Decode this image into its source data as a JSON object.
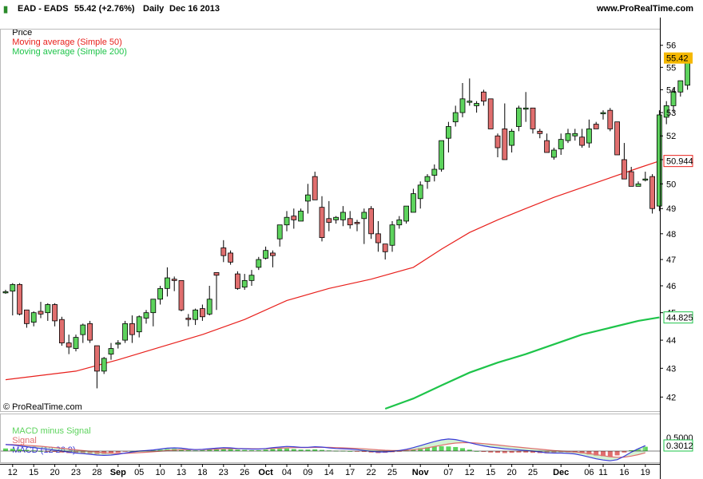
{
  "header": {
    "symbol": "EAD - EADS",
    "last_change": "55.42 (+2.76%)",
    "period": "Daily",
    "date": "Dec 16 2013",
    "site": "www.ProRealTime.com"
  },
  "legend": {
    "price": "Price",
    "ma50": "Moving average (Simple 50)",
    "ma200": "Moving average (Simple 200)",
    "macd_hist": "MACD minus Signal",
    "macd_signal": "Signal",
    "macd": "MACD (12 26 9)"
  },
  "watermark": "© ProRealTime.com",
  "colors": {
    "up": "#5dd35d",
    "down": "#e06e6e",
    "ma50": "#e8201c",
    "ma200": "#1ec44a",
    "macd": "#3a3ad8",
    "signal": "#e06e6e",
    "last_price_tag": "#f5b800"
  },
  "chart_data": {
    "type": "candlestick",
    "price_axis": {
      "ylim": [
        41.6,
        56.8
      ],
      "ticks": [
        "42",
        "43",
        "44",
        "45",
        "46",
        "47",
        "48",
        "49",
        "50",
        "51",
        "52",
        "53",
        "54",
        "55",
        "56"
      ]
    },
    "tags": {
      "last": "55.42",
      "ma50": "50.944",
      "ma200": "44.825"
    },
    "x_ticks": [
      {
        "i": 1,
        "label": "12"
      },
      {
        "i": 4,
        "label": "15"
      },
      {
        "i": 7,
        "label": "20"
      },
      {
        "i": 10,
        "label": "23"
      },
      {
        "i": 13,
        "label": "28"
      },
      {
        "i": 16,
        "label": "Sep",
        "bold": true
      },
      {
        "i": 19,
        "label": "05"
      },
      {
        "i": 22,
        "label": "10"
      },
      {
        "i": 25,
        "label": "13"
      },
      {
        "i": 28,
        "label": "18"
      },
      {
        "i": 31,
        "label": "23"
      },
      {
        "i": 34,
        "label": "26"
      },
      {
        "i": 37,
        "label": "Oct",
        "bold": true
      },
      {
        "i": 40,
        "label": "04"
      },
      {
        "i": 43,
        "label": "09"
      },
      {
        "i": 46,
        "label": "14"
      },
      {
        "i": 49,
        "label": "17"
      },
      {
        "i": 52,
        "label": "22"
      },
      {
        "i": 55,
        "label": "25"
      },
      {
        "i": 59,
        "label": "Nov",
        "bold": true
      },
      {
        "i": 63,
        "label": "07"
      },
      {
        "i": 66,
        "label": "12"
      },
      {
        "i": 69,
        "label": "15"
      },
      {
        "i": 72,
        "label": "20"
      },
      {
        "i": 75,
        "label": "25"
      },
      {
        "i": 79,
        "label": "Dec",
        "bold": true
      },
      {
        "i": 83,
        "label": "06"
      },
      {
        "i": 85,
        "label": "11"
      },
      {
        "i": 88,
        "label": "16"
      },
      {
        "i": 91,
        "label": "19"
      }
    ],
    "candles": [
      [
        45.75,
        45.85,
        45.7,
        45.78
      ],
      [
        45.8,
        46.1,
        44.9,
        46.05
      ],
      [
        46.05,
        46.1,
        44.9,
        44.95
      ],
      [
        45.1,
        45.1,
        44.45,
        44.6
      ],
      [
        44.65,
        45.05,
        44.5,
        45.0
      ],
      [
        45.05,
        45.4,
        44.8,
        44.95
      ],
      [
        45.0,
        45.35,
        44.7,
        45.3
      ],
      [
        45.3,
        45.35,
        44.5,
        44.7
      ],
      [
        44.75,
        44.85,
        43.8,
        43.9
      ],
      [
        43.9,
        44.2,
        43.5,
        43.75
      ],
      [
        43.7,
        44.2,
        43.6,
        44.1
      ],
      [
        44.2,
        44.6,
        43.9,
        44.55
      ],
      [
        44.6,
        44.7,
        43.9,
        44.0
      ],
      [
        43.8,
        43.8,
        42.3,
        42.9
      ],
      [
        42.9,
        43.4,
        42.8,
        43.35
      ],
      [
        43.5,
        43.9,
        43.3,
        43.7
      ],
      [
        43.9,
        44.0,
        43.7,
        43.9
      ],
      [
        44.0,
        44.7,
        43.9,
        44.6
      ],
      [
        44.6,
        44.9,
        43.9,
        44.2
      ],
      [
        44.3,
        44.9,
        44.1,
        44.85
      ],
      [
        44.8,
        45.1,
        44.6,
        45.0
      ],
      [
        45.0,
        45.5,
        44.5,
        45.5
      ],
      [
        45.5,
        46.0,
        45.3,
        45.9
      ],
      [
        45.9,
        46.7,
        45.6,
        46.3
      ],
      [
        46.25,
        46.35,
        45.8,
        46.2
      ],
      [
        46.2,
        46.2,
        45.05,
        45.1
      ],
      [
        44.8,
        44.95,
        44.5,
        44.75
      ],
      [
        44.75,
        45.15,
        44.55,
        45.1
      ],
      [
        45.15,
        45.3,
        44.7,
        44.85
      ],
      [
        44.95,
        46.0,
        44.9,
        45.5
      ],
      [
        46.5,
        46.5,
        45.1,
        46.4
      ],
      [
        47.45,
        47.75,
        46.9,
        47.15
      ],
      [
        47.25,
        47.35,
        46.8,
        46.9
      ],
      [
        46.45,
        46.55,
        45.85,
        45.9
      ],
      [
        45.95,
        46.45,
        45.85,
        46.2
      ],
      [
        46.2,
        46.6,
        46.0,
        46.4
      ],
      [
        46.7,
        47.1,
        46.6,
        47.0
      ],
      [
        47.05,
        47.5,
        47.0,
        47.35
      ],
      [
        47.25,
        47.35,
        46.7,
        47.15
      ],
      [
        47.8,
        48.3,
        47.5,
        48.35
      ],
      [
        48.35,
        48.9,
        48.1,
        48.65
      ],
      [
        48.7,
        49.0,
        48.2,
        48.55
      ],
      [
        48.5,
        49.0,
        48.6,
        48.9
      ],
      [
        49.3,
        50.0,
        48.8,
        49.55
      ],
      [
        50.3,
        50.5,
        49.4,
        49.35
      ],
      [
        49.05,
        49.5,
        47.7,
        47.85
      ],
      [
        48.6,
        49.3,
        48.1,
        48.45
      ],
      [
        48.55,
        48.7,
        48.4,
        48.65
      ],
      [
        48.55,
        49.1,
        48.3,
        48.85
      ],
      [
        48.6,
        48.9,
        48.2,
        48.35
      ],
      [
        48.45,
        48.55,
        48.1,
        48.4
      ],
      [
        48.6,
        49.0,
        47.6,
        48.85
      ],
      [
        49.0,
        49.1,
        47.8,
        48.0
      ],
      [
        48.0,
        48.5,
        47.3,
        47.65
      ],
      [
        47.6,
        47.6,
        47.0,
        47.3
      ],
      [
        47.55,
        48.5,
        47.3,
        48.35
      ],
      [
        48.35,
        48.7,
        48.2,
        48.55
      ],
      [
        48.5,
        49.1,
        48.4,
        49.1
      ],
      [
        48.85,
        49.8,
        48.9,
        49.6
      ],
      [
        49.4,
        50.1,
        49.0,
        49.95
      ],
      [
        50.1,
        50.4,
        49.8,
        50.3
      ],
      [
        50.35,
        50.8,
        50.1,
        50.6
      ],
      [
        50.6,
        51.8,
        50.5,
        51.8
      ],
      [
        51.9,
        52.6,
        51.3,
        52.4
      ],
      [
        52.6,
        53.3,
        52.4,
        53.0
      ],
      [
        53.0,
        54.3,
        52.8,
        53.6
      ],
      [
        53.5,
        54.5,
        53.3,
        53.5
      ],
      [
        53.3,
        53.5,
        53.0,
        53.4
      ],
      [
        53.9,
        54.0,
        53.3,
        53.5
      ],
      [
        53.6,
        53.6,
        52.3,
        52.3
      ],
      [
        52.0,
        52.1,
        51.1,
        51.5
      ],
      [
        52.3,
        53.4,
        51.0,
        51.0
      ],
      [
        51.6,
        52.3,
        51.3,
        52.2
      ],
      [
        52.4,
        53.3,
        52.2,
        53.2
      ],
      [
        53.2,
        53.9,
        52.6,
        53.2
      ],
      [
        53.2,
        53.2,
        52.1,
        52.3
      ],
      [
        52.2,
        52.3,
        51.9,
        52.1
      ],
      [
        51.8,
        52.1,
        51.3,
        51.3
      ],
      [
        51.1,
        51.5,
        51.0,
        51.4
      ],
      [
        51.45,
        52.1,
        51.2,
        51.85
      ],
      [
        51.8,
        52.3,
        51.7,
        52.1
      ],
      [
        52.0,
        52.3,
        51.8,
        52.1
      ],
      [
        51.95,
        52.3,
        51.5,
        51.6
      ],
      [
        51.7,
        52.7,
        51.5,
        52.3
      ],
      [
        52.5,
        52.6,
        52.3,
        52.3
      ],
      [
        53.0,
        53.1,
        52.7,
        53.0
      ],
      [
        53.1,
        53.2,
        52.2,
        52.3
      ],
      [
        52.6,
        52.6,
        51.2,
        51.2
      ],
      [
        51.0,
        51.7,
        50.2,
        50.2
      ],
      [
        50.5,
        50.7,
        49.9,
        49.9
      ],
      [
        49.9,
        50.1,
        49.9,
        50.0
      ],
      [
        50.2,
        50.5,
        50.1,
        50.2
      ],
      [
        50.3,
        50.4,
        48.8,
        49.0
      ],
      [
        49.1,
        53.1,
        48.9,
        52.9
      ],
      [
        52.8,
        53.5,
        52.5,
        53.3
      ],
      [
        53.3,
        54.1,
        53.0,
        53.9
      ],
      [
        53.9,
        54.4,
        53.7,
        54.4
      ],
      [
        54.2,
        55.6,
        54.0,
        55.42
      ]
    ],
    "ma50": [
      [
        0,
        42.6
      ],
      [
        10,
        42.9
      ],
      [
        16,
        43.3
      ],
      [
        22,
        43.75
      ],
      [
        28,
        44.2
      ],
      [
        34,
        44.75
      ],
      [
        40,
        45.45
      ],
      [
        46,
        45.9
      ],
      [
        52,
        46.25
      ],
      [
        58,
        46.7
      ],
      [
        62,
        47.4
      ],
      [
        66,
        48.05
      ],
      [
        70,
        48.55
      ],
      [
        74,
        49.0
      ],
      [
        78,
        49.45
      ],
      [
        82,
        49.85
      ],
      [
        86,
        50.25
      ],
      [
        90,
        50.65
      ],
      [
        93,
        50.944
      ]
    ],
    "ma200": [
      [
        54,
        41.6
      ],
      [
        58,
        41.95
      ],
      [
        62,
        42.4
      ],
      [
        66,
        42.85
      ],
      [
        70,
        43.2
      ],
      [
        74,
        43.5
      ],
      [
        78,
        43.85
      ],
      [
        82,
        44.2
      ],
      [
        86,
        44.45
      ],
      [
        90,
        44.7
      ],
      [
        93,
        44.825
      ]
    ],
    "macd_axis": {
      "tags": [
        "0.5000",
        "0.3012"
      ]
    },
    "macd_hist": [
      0.18,
      0.16,
      0.12,
      0.08,
      0.04,
      0.0,
      -0.04,
      -0.06,
      -0.1,
      -0.14,
      -0.16,
      -0.16,
      -0.18,
      -0.22,
      -0.2,
      -0.16,
      -0.1,
      -0.04,
      0.0,
      0.02,
      0.04,
      0.05,
      0.1,
      0.14,
      0.16,
      0.12,
      0.06,
      0.04,
      0.06,
      0.1,
      0.14,
      0.16,
      0.14,
      0.1,
      0.08,
      0.06,
      0.06,
      0.1,
      0.14,
      0.16,
      0.18,
      0.14,
      0.1,
      0.1,
      0.12,
      0.08,
      0.04,
      0.02,
      0.02,
      0.0,
      -0.04,
      -0.06,
      -0.1,
      -0.14,
      -0.12,
      -0.08,
      -0.04,
      0.04,
      0.12,
      0.2,
      0.26,
      0.32,
      0.34,
      0.32,
      0.28,
      0.2,
      0.1,
      0.0,
      -0.06,
      -0.1,
      -0.12,
      -0.14,
      -0.12,
      -0.1,
      -0.1,
      -0.12,
      -0.14,
      -0.16,
      -0.12,
      -0.08,
      -0.08,
      -0.1,
      -0.16,
      -0.24,
      -0.32,
      -0.36,
      -0.4,
      -0.3,
      -0.1,
      0.06,
      0.14,
      0.3
    ],
    "macd_line": [
      0.45,
      0.42,
      0.36,
      0.3,
      0.24,
      0.18,
      0.12,
      0.06,
      0.0,
      -0.08,
      -0.14,
      -0.18,
      -0.22,
      -0.28,
      -0.3,
      -0.28,
      -0.22,
      -0.14,
      -0.06,
      0.0,
      0.04,
      0.08,
      0.14,
      0.2,
      0.22,
      0.2,
      0.14,
      0.1,
      0.12,
      0.16,
      0.2,
      0.24,
      0.22,
      0.18,
      0.16,
      0.14,
      0.14,
      0.18,
      0.24,
      0.28,
      0.32,
      0.3,
      0.26,
      0.26,
      0.3,
      0.28,
      0.22,
      0.18,
      0.16,
      0.14,
      0.1,
      0.04,
      -0.02,
      -0.06,
      -0.06,
      -0.02,
      0.04,
      0.12,
      0.24,
      0.38,
      0.52,
      0.66,
      0.78,
      0.84,
      0.8,
      0.7,
      0.58,
      0.46,
      0.36,
      0.28,
      0.22,
      0.16,
      0.12,
      0.08,
      0.04,
      0.0,
      -0.06,
      -0.12,
      -0.14,
      -0.14,
      -0.16,
      -0.2,
      -0.3,
      -0.42,
      -0.54,
      -0.62,
      -0.68,
      -0.6,
      -0.36,
      -0.08,
      0.16,
      0.38
    ]
  }
}
